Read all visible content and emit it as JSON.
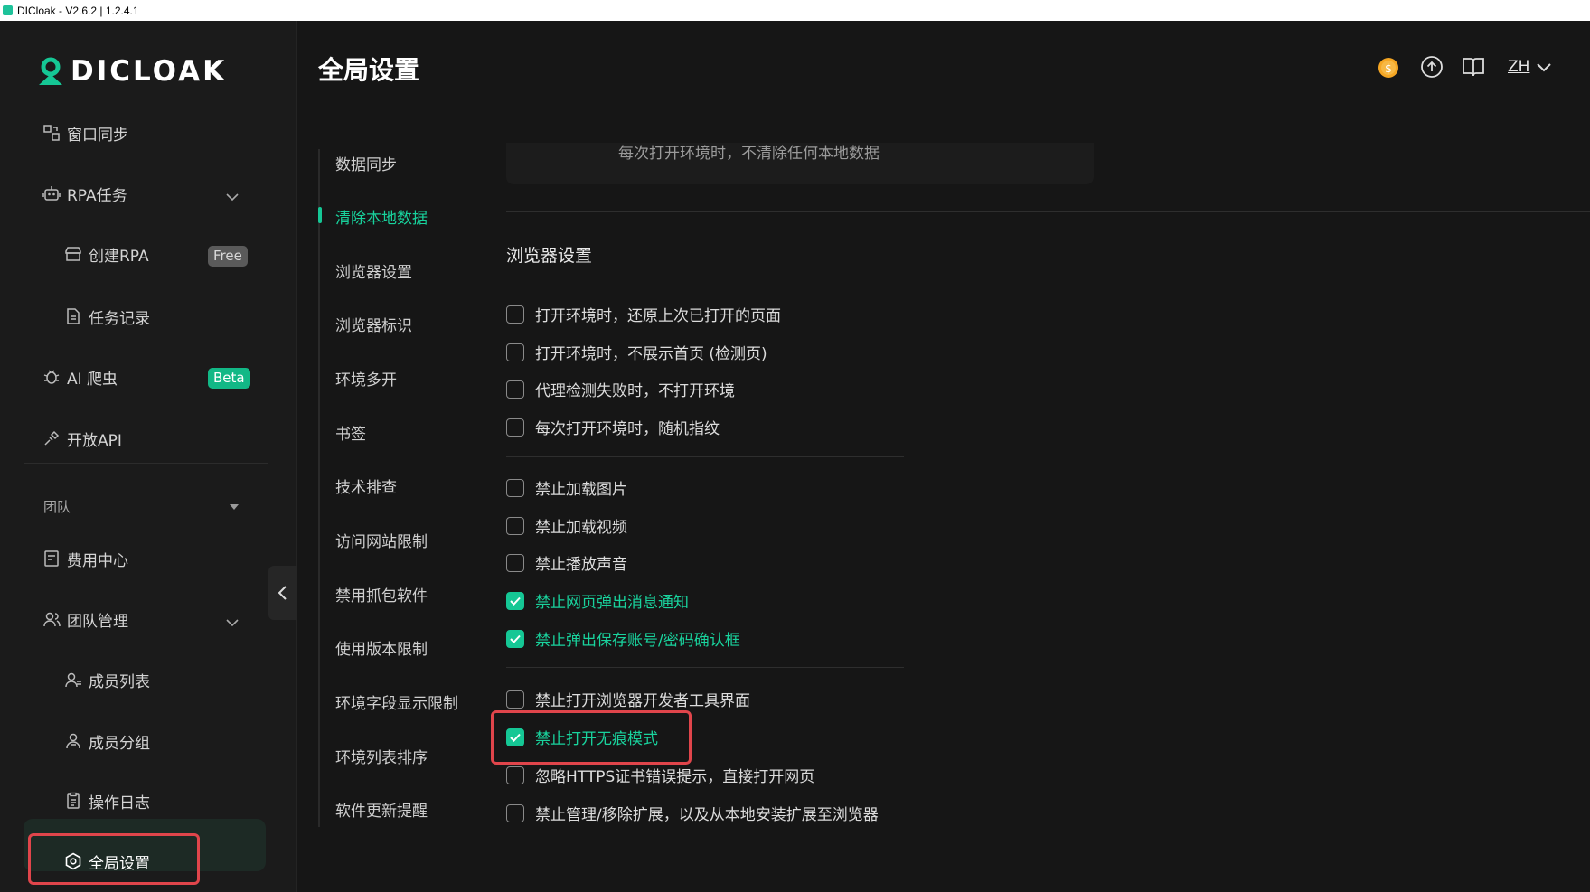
{
  "window": {
    "title": "DICloak - V2.6.2 | 1.2.4.1"
  },
  "brand": {
    "name": "DICLOAK",
    "accent": "#15c795"
  },
  "sidebar": {
    "items": [
      {
        "label": "窗口同步",
        "icon": "window-sync-icon"
      },
      {
        "label": "RPA任务",
        "icon": "robot-icon"
      },
      {
        "label": "创建RPA",
        "icon": "store-icon",
        "badge": "Free"
      },
      {
        "label": "任务记录",
        "icon": "document-icon"
      },
      {
        "label": "AI 爬虫",
        "icon": "bug-icon",
        "badge": "Beta"
      },
      {
        "label": "开放API",
        "icon": "plug-icon"
      },
      {
        "label": "费用中心",
        "icon": "billing-icon"
      },
      {
        "label": "团队管理",
        "icon": "team-icon"
      },
      {
        "label": "成员列表",
        "icon": "member-icon"
      },
      {
        "label": "成员分组",
        "icon": "member-group-icon"
      },
      {
        "label": "操作日志",
        "icon": "clipboard-icon"
      },
      {
        "label": "全局设置",
        "icon": "settings-hex-icon"
      }
    ],
    "team_label": "团队"
  },
  "header": {
    "title": "全局设置",
    "language": "ZH"
  },
  "subnav": {
    "items": [
      "数据同步",
      "清除本地数据",
      "浏览器设置",
      "浏览器标识",
      "环境多开",
      "书签",
      "技术排查",
      "访问网站限制",
      "禁用抓包软件",
      "使用版本限制",
      "环境字段显示限制",
      "环境列表排序",
      "软件更新提醒"
    ],
    "active": "清除本地数据"
  },
  "content": {
    "top_card_text": "每次打开环境时，不清除任何本地数据",
    "section_title": "浏览器设置",
    "options": [
      {
        "label": "打开环境时，还原上次已打开的页面",
        "checked": false
      },
      {
        "label": "打开环境时，不展示首页 (检测页)",
        "checked": false
      },
      {
        "label": "代理检测失败时，不打开环境",
        "checked": false
      },
      {
        "label": "每次打开环境时，随机指纹",
        "checked": false
      },
      {
        "label": "禁止加载图片",
        "checked": false
      },
      {
        "label": "禁止加载视频",
        "checked": false
      },
      {
        "label": "禁止播放声音",
        "checked": false
      },
      {
        "label": "禁止网页弹出消息通知",
        "checked": true
      },
      {
        "label": "禁止弹出保存账号/密码确认框",
        "checked": true
      },
      {
        "label": "禁止打开浏览器开发者工具界面",
        "checked": false
      },
      {
        "label": "禁止打开无痕模式",
        "checked": true
      },
      {
        "label": "忽略HTTPS证书错误提示，直接打开网页",
        "checked": false
      },
      {
        "label": "禁止管理/移除扩展，以及从本地安装扩展至浏览器",
        "checked": false
      }
    ]
  }
}
